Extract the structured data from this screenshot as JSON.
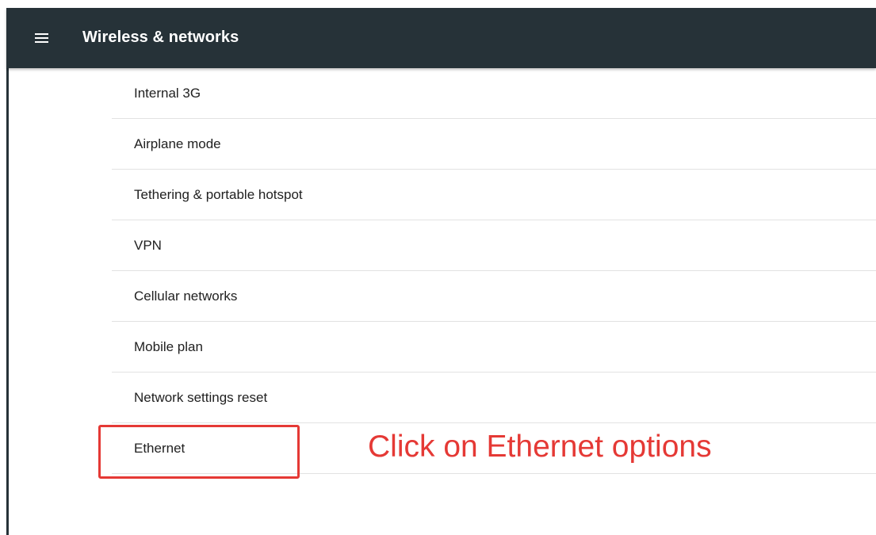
{
  "header": {
    "title": "Wireless & networks",
    "menu_icon": "hamburger-menu-icon",
    "background_color": "#263238"
  },
  "settings_list": {
    "items": [
      {
        "label": "Internal 3G"
      },
      {
        "label": "Airplane mode"
      },
      {
        "label": "Tethering & portable hotspot"
      },
      {
        "label": "VPN"
      },
      {
        "label": "Cellular networks"
      },
      {
        "label": "Mobile plan"
      },
      {
        "label": "Network settings reset"
      },
      {
        "label": "Ethernet"
      }
    ]
  },
  "annotation": {
    "text": "Click on Ethernet options",
    "color": "#e53935"
  }
}
